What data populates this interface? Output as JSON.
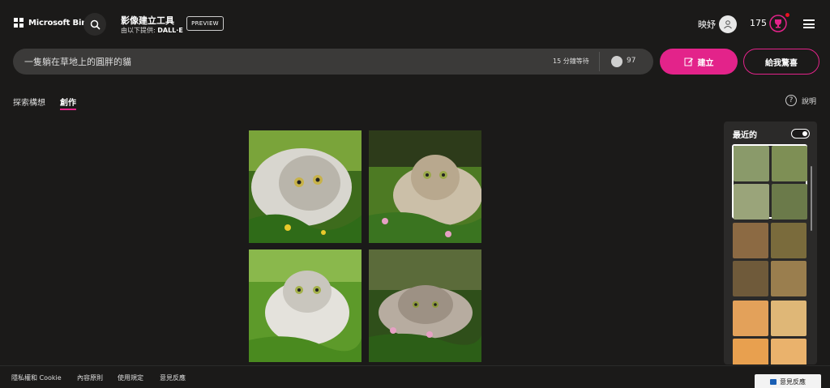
{
  "header": {
    "brand": "Microsoft Bing",
    "app_title": "影像建立工具",
    "provider_prefix": "由以下提供:",
    "provider_name": "DALL·E",
    "preview_badge": "PREVIEW",
    "user_greeting": "映妤",
    "coin_count": "175",
    "icons": [
      "microsoft-logo",
      "search-icon",
      "user-avatar-icon",
      "rewards-trophy-icon",
      "hamburger-menu-icon"
    ]
  },
  "prompt": {
    "value": "一隻躺在草地上的圓胖的貓",
    "wait_text": "15 分鐘等待",
    "boost_count": "97",
    "create_label": "建立",
    "surprise_label": "給我驚喜"
  },
  "tabs": [
    {
      "label": "探索構想",
      "active": false
    },
    {
      "label": "創作",
      "active": true
    }
  ],
  "help_label": "說明",
  "results": {
    "count": 4
  },
  "recent": {
    "title": "最近的",
    "toggle_on": true
  },
  "footer": {
    "links": [
      "隱私權和 Cookie",
      "內容原則",
      "使用規定",
      "意見反應"
    ],
    "feedback_button": "意見反應"
  },
  "colors": {
    "background": "#1b1a19",
    "accent": "#e3238a",
    "input_bg": "#3b3a39"
  }
}
